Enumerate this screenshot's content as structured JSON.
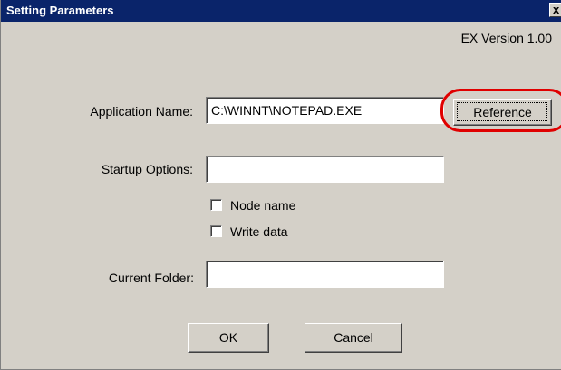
{
  "window": {
    "title": "Setting Parameters",
    "close_glyph": "x"
  },
  "version": "EX Version 1.00",
  "fields": {
    "application_name": {
      "label": "Application Name:",
      "value": "C:\\WINNT\\NOTEPAD.EXE"
    },
    "startup_options": {
      "label": "Startup Options:",
      "value": ""
    },
    "current_folder": {
      "label": "Current Folder:",
      "value": ""
    }
  },
  "reference_button": "Reference",
  "checkboxes": [
    {
      "label": "Node name",
      "checked": false
    },
    {
      "label": "Write data",
      "checked": false
    }
  ],
  "ok_button": "OK",
  "cancel_button": "Cancel",
  "annotation_color": "#e00000",
  "titlebar_color": "#0a246a",
  "dialog_color": "#d4d0c8"
}
